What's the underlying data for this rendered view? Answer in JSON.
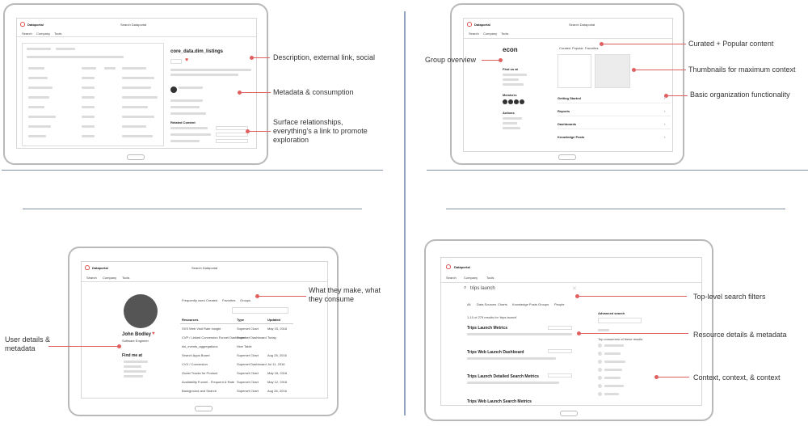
{
  "app": {
    "name": "Dataportal",
    "search_placeholder": "Search Dataportal"
  },
  "nav_tabs": [
    "Search",
    "Company",
    "Tools"
  ],
  "q1": {
    "table_title": "core_data.dim_listings",
    "annotations": [
      "Description, external link, social",
      "Metadata & consumption",
      "Surface relationships, everything's a link to promote exploration"
    ],
    "related_label": "Related Content"
  },
  "q2": {
    "group_name": "econ",
    "tabs": [
      "Curated",
      "Popular",
      "Favorites"
    ],
    "find_label": "Find us at",
    "members_label": "Members",
    "actions_label": "Actions",
    "sections": [
      "Getting Started",
      "Reports",
      "Dashboards",
      "Knowledge Posts"
    ],
    "annotations": [
      "Group overview",
      "Curated + Popular content",
      "Thumbnails for maximum context",
      "Basic organization functionality"
    ]
  },
  "q3": {
    "user_name": "John Bodley",
    "user_title": "Software Engineer",
    "find_label": "Find me at",
    "tabs": [
      "Frequently used",
      "Created",
      "Favorites",
      "Groups"
    ],
    "columns": [
      "Resources",
      "Type",
      "Updated"
    ],
    "rows": [
      [
        "SXS Web Visit Rate Insight",
        "Superset Chart",
        "May 15, 2016"
      ],
      [
        "CVP / Linked Conversion Funnel Dashboard",
        "Superset Dashboard",
        "Today"
      ],
      [
        "dw_events_aggregations",
        "Hive Table",
        ""
      ],
      [
        "Search Apps Board",
        "Superset Chart",
        "Aug 28, 2016"
      ],
      [
        "CVX / Conversion",
        "Superset Dashboard",
        "Jul 11, 2016"
      ],
      [
        "Guest Tracks for Product",
        "Superset Chart",
        "May 18, 2016"
      ],
      [
        "Availability Funnel - Frequent & Rate",
        "Superset Chart",
        "May 12, 2016"
      ],
      [
        "Background and Search",
        "Superset Chart",
        "Aug 26, 2016"
      ]
    ],
    "annotations": [
      "What they make, what they consume",
      "User details & metadata"
    ]
  },
  "q4": {
    "query": "trips launch",
    "filters": [
      "All",
      "Data Sources",
      "Charts",
      "Knowledge Posts",
      "Groups",
      "People"
    ],
    "results_count": "1-10 of 279 results for 'trips launch'",
    "results": [
      "Trips Launch Metrics",
      "Trips Web Launch Dashboard",
      "Trips Launch Detailed Search Metrics",
      "Trips Web Launch Search Metrics"
    ],
    "sidebar_title": "Advanced search",
    "consumers_title": "Top consumers of these results",
    "annotations": [
      "Top-level search filters",
      "Resource details & metadata",
      "Context, context, & context"
    ]
  }
}
